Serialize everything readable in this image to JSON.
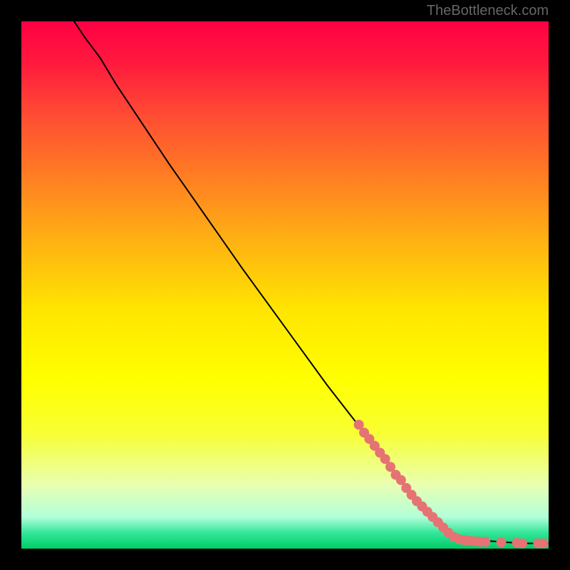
{
  "watermark": "TheBottleneck.com",
  "chart_data": {
    "type": "line",
    "title": "",
    "xlabel": "",
    "ylabel": "",
    "xlim": [
      0,
      100
    ],
    "ylim": [
      0,
      100
    ],
    "line_points": [
      {
        "x": 10,
        "y": 100
      },
      {
        "x": 12,
        "y": 97
      },
      {
        "x": 15,
        "y": 93
      },
      {
        "x": 18,
        "y": 88
      },
      {
        "x": 22,
        "y": 82
      },
      {
        "x": 28,
        "y": 73
      },
      {
        "x": 35,
        "y": 63
      },
      {
        "x": 42,
        "y": 53
      },
      {
        "x": 50,
        "y": 42
      },
      {
        "x": 58,
        "y": 31
      },
      {
        "x": 65,
        "y": 22
      },
      {
        "x": 72,
        "y": 13
      },
      {
        "x": 78,
        "y": 6
      },
      {
        "x": 82,
        "y": 2.5
      },
      {
        "x": 85,
        "y": 1.8
      },
      {
        "x": 88,
        "y": 1.5
      },
      {
        "x": 92,
        "y": 1.2
      },
      {
        "x": 96,
        "y": 1.0
      },
      {
        "x": 100,
        "y": 1.0
      }
    ],
    "scatter_points": [
      {
        "x": 64,
        "y": 23.5
      },
      {
        "x": 65,
        "y": 22.0
      },
      {
        "x": 66,
        "y": 20.8
      },
      {
        "x": 67,
        "y": 19.5
      },
      {
        "x": 68,
        "y": 18.2
      },
      {
        "x": 69,
        "y": 17.0
      },
      {
        "x": 70,
        "y": 15.5
      },
      {
        "x": 71,
        "y": 14.0
      },
      {
        "x": 72,
        "y": 13.0
      },
      {
        "x": 73,
        "y": 11.5
      },
      {
        "x": 74,
        "y": 10.2
      },
      {
        "x": 75,
        "y": 9.0
      },
      {
        "x": 76,
        "y": 8.0
      },
      {
        "x": 77,
        "y": 7.0
      },
      {
        "x": 78,
        "y": 6.0
      },
      {
        "x": 79,
        "y": 5.0
      },
      {
        "x": 80,
        "y": 4.0
      },
      {
        "x": 81,
        "y": 3.0
      },
      {
        "x": 82,
        "y": 2.2
      },
      {
        "x": 83,
        "y": 1.8
      },
      {
        "x": 84,
        "y": 1.6
      },
      {
        "x": 85,
        "y": 1.5
      },
      {
        "x": 86,
        "y": 1.4
      },
      {
        "x": 87,
        "y": 1.3
      },
      {
        "x": 88,
        "y": 1.3
      },
      {
        "x": 91,
        "y": 1.2
      },
      {
        "x": 94,
        "y": 1.1
      },
      {
        "x": 95,
        "y": 1.0
      },
      {
        "x": 98,
        "y": 1.0
      },
      {
        "x": 99,
        "y": 1.0
      }
    ],
    "colors": {
      "line": "#000000",
      "dot": "#e57373"
    }
  }
}
